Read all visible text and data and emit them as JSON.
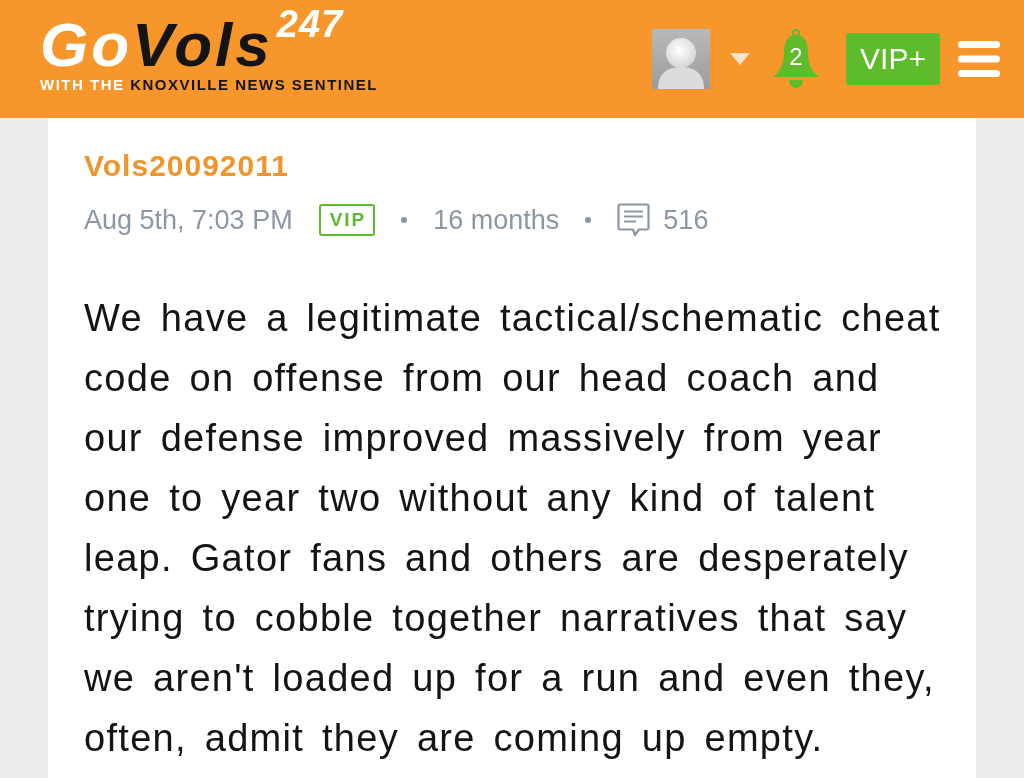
{
  "header": {
    "logo": {
      "wordmark_light": "Go",
      "wordmark_dark": "Vols",
      "superscript": "247",
      "tagline_light": "WITH THE",
      "tagline_dark": "KNOXVILLE NEWS SENTINEL"
    },
    "notifications": {
      "count": "2"
    },
    "upgrade_button": "VIP+"
  },
  "post": {
    "author": "Vols20092011",
    "timestamp": "Aug 5th, 7:03 PM",
    "badge": "VIP",
    "member_for": "16 months",
    "post_count": "516",
    "body": "We have a legitimate tactical/schematic cheat code on offense from our head coach and our defense improved massively from year one to year two without any kind of talent leap. Gator fans and others are desperately trying to cobble together narratives that say we aren't loaded up for a run and even they, often, admit they are coming up empty."
  }
}
